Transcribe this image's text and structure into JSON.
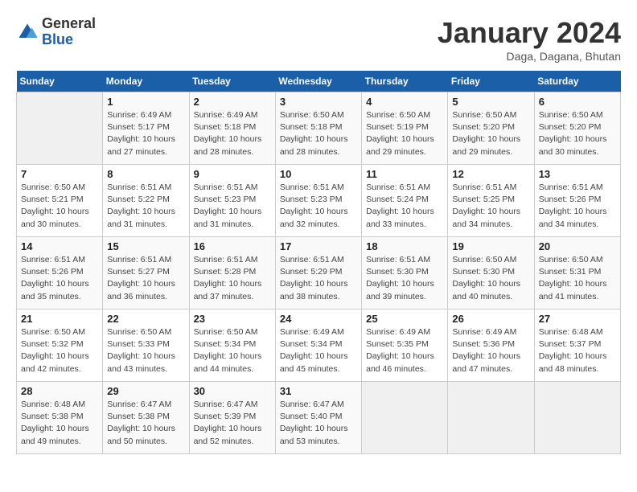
{
  "header": {
    "logo_general": "General",
    "logo_blue": "Blue",
    "month_title": "January 2024",
    "location": "Daga, Dagana, Bhutan"
  },
  "calendar": {
    "days_of_week": [
      "Sunday",
      "Monday",
      "Tuesday",
      "Wednesday",
      "Thursday",
      "Friday",
      "Saturday"
    ],
    "weeks": [
      [
        {
          "day": "",
          "info": ""
        },
        {
          "day": "1",
          "info": "Sunrise: 6:49 AM\nSunset: 5:17 PM\nDaylight: 10 hours\nand 27 minutes."
        },
        {
          "day": "2",
          "info": "Sunrise: 6:49 AM\nSunset: 5:18 PM\nDaylight: 10 hours\nand 28 minutes."
        },
        {
          "day": "3",
          "info": "Sunrise: 6:50 AM\nSunset: 5:18 PM\nDaylight: 10 hours\nand 28 minutes."
        },
        {
          "day": "4",
          "info": "Sunrise: 6:50 AM\nSunset: 5:19 PM\nDaylight: 10 hours\nand 29 minutes."
        },
        {
          "day": "5",
          "info": "Sunrise: 6:50 AM\nSunset: 5:20 PM\nDaylight: 10 hours\nand 29 minutes."
        },
        {
          "day": "6",
          "info": "Sunrise: 6:50 AM\nSunset: 5:20 PM\nDaylight: 10 hours\nand 30 minutes."
        }
      ],
      [
        {
          "day": "7",
          "info": "Sunrise: 6:50 AM\nSunset: 5:21 PM\nDaylight: 10 hours\nand 30 minutes."
        },
        {
          "day": "8",
          "info": "Sunrise: 6:51 AM\nSunset: 5:22 PM\nDaylight: 10 hours\nand 31 minutes."
        },
        {
          "day": "9",
          "info": "Sunrise: 6:51 AM\nSunset: 5:23 PM\nDaylight: 10 hours\nand 31 minutes."
        },
        {
          "day": "10",
          "info": "Sunrise: 6:51 AM\nSunset: 5:23 PM\nDaylight: 10 hours\nand 32 minutes."
        },
        {
          "day": "11",
          "info": "Sunrise: 6:51 AM\nSunset: 5:24 PM\nDaylight: 10 hours\nand 33 minutes."
        },
        {
          "day": "12",
          "info": "Sunrise: 6:51 AM\nSunset: 5:25 PM\nDaylight: 10 hours\nand 34 minutes."
        },
        {
          "day": "13",
          "info": "Sunrise: 6:51 AM\nSunset: 5:26 PM\nDaylight: 10 hours\nand 34 minutes."
        }
      ],
      [
        {
          "day": "14",
          "info": "Sunrise: 6:51 AM\nSunset: 5:26 PM\nDaylight: 10 hours\nand 35 minutes."
        },
        {
          "day": "15",
          "info": "Sunrise: 6:51 AM\nSunset: 5:27 PM\nDaylight: 10 hours\nand 36 minutes."
        },
        {
          "day": "16",
          "info": "Sunrise: 6:51 AM\nSunset: 5:28 PM\nDaylight: 10 hours\nand 37 minutes."
        },
        {
          "day": "17",
          "info": "Sunrise: 6:51 AM\nSunset: 5:29 PM\nDaylight: 10 hours\nand 38 minutes."
        },
        {
          "day": "18",
          "info": "Sunrise: 6:51 AM\nSunset: 5:30 PM\nDaylight: 10 hours\nand 39 minutes."
        },
        {
          "day": "19",
          "info": "Sunrise: 6:50 AM\nSunset: 5:30 PM\nDaylight: 10 hours\nand 40 minutes."
        },
        {
          "day": "20",
          "info": "Sunrise: 6:50 AM\nSunset: 5:31 PM\nDaylight: 10 hours\nand 41 minutes."
        }
      ],
      [
        {
          "day": "21",
          "info": "Sunrise: 6:50 AM\nSunset: 5:32 PM\nDaylight: 10 hours\nand 42 minutes."
        },
        {
          "day": "22",
          "info": "Sunrise: 6:50 AM\nSunset: 5:33 PM\nDaylight: 10 hours\nand 43 minutes."
        },
        {
          "day": "23",
          "info": "Sunrise: 6:50 AM\nSunset: 5:34 PM\nDaylight: 10 hours\nand 44 minutes."
        },
        {
          "day": "24",
          "info": "Sunrise: 6:49 AM\nSunset: 5:34 PM\nDaylight: 10 hours\nand 45 minutes."
        },
        {
          "day": "25",
          "info": "Sunrise: 6:49 AM\nSunset: 5:35 PM\nDaylight: 10 hours\nand 46 minutes."
        },
        {
          "day": "26",
          "info": "Sunrise: 6:49 AM\nSunset: 5:36 PM\nDaylight: 10 hours\nand 47 minutes."
        },
        {
          "day": "27",
          "info": "Sunrise: 6:48 AM\nSunset: 5:37 PM\nDaylight: 10 hours\nand 48 minutes."
        }
      ],
      [
        {
          "day": "28",
          "info": "Sunrise: 6:48 AM\nSunset: 5:38 PM\nDaylight: 10 hours\nand 49 minutes."
        },
        {
          "day": "29",
          "info": "Sunrise: 6:47 AM\nSunset: 5:38 PM\nDaylight: 10 hours\nand 50 minutes."
        },
        {
          "day": "30",
          "info": "Sunrise: 6:47 AM\nSunset: 5:39 PM\nDaylight: 10 hours\nand 52 minutes."
        },
        {
          "day": "31",
          "info": "Sunrise: 6:47 AM\nSunset: 5:40 PM\nDaylight: 10 hours\nand 53 minutes."
        },
        {
          "day": "",
          "info": ""
        },
        {
          "day": "",
          "info": ""
        },
        {
          "day": "",
          "info": ""
        }
      ]
    ]
  }
}
